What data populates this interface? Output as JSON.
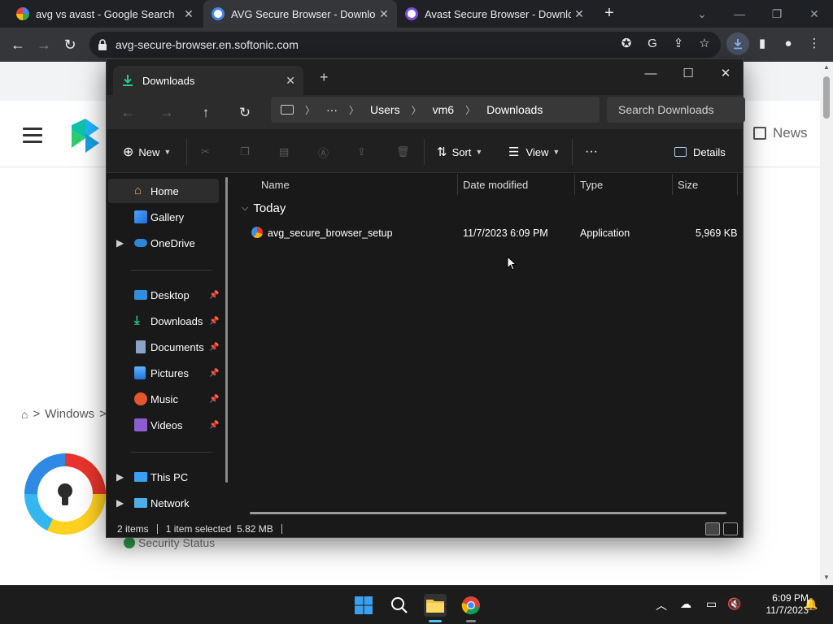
{
  "browser": {
    "tabs": [
      {
        "title": "avg vs avast - Google Search",
        "active": false
      },
      {
        "title": "AVG Secure Browser - Download",
        "active": true
      },
      {
        "title": "Avast Secure Browser - Download",
        "active": false
      }
    ],
    "url": "avg-secure-browser.en.softonic.com"
  },
  "webpage": {
    "news_label": "News",
    "breadcrumb": [
      "Windows"
    ],
    "breadcrumb_sep": ">",
    "security_status": "Security Status"
  },
  "explorer": {
    "tab_title": "Downloads",
    "address": {
      "more": "···",
      "segments": [
        "Users",
        "vm6",
        "Downloads"
      ]
    },
    "search_placeholder": "Search Downloads",
    "toolbar": {
      "new_label": "New",
      "sort_label": "Sort",
      "view_label": "View",
      "more_label": "···",
      "details_label": "Details"
    },
    "nav": {
      "top": [
        {
          "label": "Home",
          "icon": "home-icon",
          "selected": true,
          "expandable": false
        },
        {
          "label": "Gallery",
          "icon": "gallery-icon",
          "selected": false,
          "expandable": false
        },
        {
          "label": "OneDrive",
          "icon": "onedrive-icon",
          "selected": false,
          "expandable": true
        }
      ],
      "pinned": [
        {
          "label": "Desktop",
          "icon": "desktop-icon"
        },
        {
          "label": "Downloads",
          "icon": "downloads-icon"
        },
        {
          "label": "Documents",
          "icon": "documents-icon"
        },
        {
          "label": "Pictures",
          "icon": "pictures-icon"
        },
        {
          "label": "Music",
          "icon": "music-icon"
        },
        {
          "label": "Videos",
          "icon": "videos-icon"
        }
      ],
      "bottom": [
        {
          "label": "This PC",
          "icon": "this-pc-icon"
        },
        {
          "label": "Network",
          "icon": "network-icon"
        }
      ]
    },
    "columns": {
      "name": "Name",
      "date": "Date modified",
      "type": "Type",
      "size": "Size"
    },
    "group_label": "Today",
    "files": [
      {
        "name": "avg_secure_browser_setup",
        "date": "11/7/2023 6:09 PM",
        "type": "Application",
        "size": "5,969 KB"
      }
    ],
    "status": {
      "count": "2 items",
      "selection": "1 item selected  5.82 MB"
    }
  },
  "taskbar": {
    "time": "6:09 PM",
    "date": "11/7/2023"
  },
  "colors": {
    "explorer_bg": "#191919",
    "chrome_dark": "#202124",
    "accent": "#4cc2ff"
  }
}
